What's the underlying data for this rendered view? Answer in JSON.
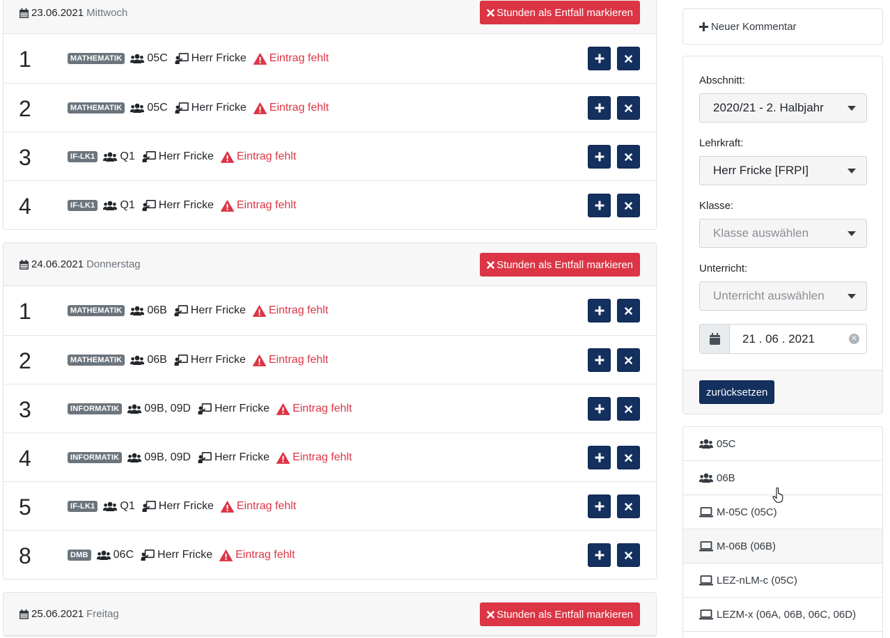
{
  "days": [
    {
      "date": "23.06.2021",
      "weekday": "Mittwoch",
      "entfall_label": "Stunden als Entfall markieren",
      "lessons": [
        {
          "num": "1",
          "subject": "MATHEMATIK",
          "group": "05C",
          "teacher": "Herr Fricke",
          "status": "Eintrag fehlt"
        },
        {
          "num": "2",
          "subject": "MATHEMATIK",
          "group": "05C",
          "teacher": "Herr Fricke",
          "status": "Eintrag fehlt"
        },
        {
          "num": "3",
          "subject": "IF-LK1",
          "group": "Q1",
          "teacher": "Herr Fricke",
          "status": "Eintrag fehlt"
        },
        {
          "num": "4",
          "subject": "IF-LK1",
          "group": "Q1",
          "teacher": "Herr Fricke",
          "status": "Eintrag fehlt"
        }
      ]
    },
    {
      "date": "24.06.2021",
      "weekday": "Donnerstag",
      "entfall_label": "Stunden als Entfall markieren",
      "lessons": [
        {
          "num": "1",
          "subject": "MATHEMATIK",
          "group": "06B",
          "teacher": "Herr Fricke",
          "status": "Eintrag fehlt"
        },
        {
          "num": "2",
          "subject": "MATHEMATIK",
          "group": "06B",
          "teacher": "Herr Fricke",
          "status": "Eintrag fehlt"
        },
        {
          "num": "3",
          "subject": "INFORMATIK",
          "group": "09B, 09D",
          "teacher": "Herr Fricke",
          "status": "Eintrag fehlt"
        },
        {
          "num": "4",
          "subject": "INFORMATIK",
          "group": "09B, 09D",
          "teacher": "Herr Fricke",
          "status": "Eintrag fehlt"
        },
        {
          "num": "5",
          "subject": "IF-LK1",
          "group": "Q1",
          "teacher": "Herr Fricke",
          "status": "Eintrag fehlt"
        },
        {
          "num": "8",
          "subject": "DMB",
          "group": "06C",
          "teacher": "Herr Fricke",
          "status": "Eintrag fehlt"
        }
      ]
    },
    {
      "date": "25.06.2021",
      "weekday": "Freitag",
      "entfall_label": "Stunden als Entfall markieren",
      "lessons": []
    }
  ],
  "sidebar": {
    "new_comment_label": "Neuer Kommentar",
    "filters": {
      "abschnitt_label": "Abschnitt:",
      "abschnitt_value": "2020/21 - 2. Halbjahr",
      "lehrkraft_label": "Lehrkraft:",
      "lehrkraft_value": "Herr Fricke [FRPI]",
      "klasse_label": "Klasse:",
      "klasse_placeholder": "Klasse auswählen",
      "unterricht_label": "Unterricht:",
      "unterricht_placeholder": "Unterricht auswählen",
      "date_value": "21 . 06 . 2021",
      "reset_label": "zurücksetzen"
    },
    "list": [
      {
        "type": "group",
        "label": "05C"
      },
      {
        "type": "group",
        "label": "06B"
      },
      {
        "type": "course",
        "label": "M-05C (05C)"
      },
      {
        "type": "course",
        "label": "M-06B (06B)"
      },
      {
        "type": "course",
        "label": "LEZ-nLM-c (05C)"
      },
      {
        "type": "course",
        "label": "LEZM-x (06A, 06B, 06C, 06D)"
      }
    ]
  },
  "colors": {
    "danger": "#dc3545",
    "primary_dark": "#14305e",
    "badge": "#6c757d"
  }
}
